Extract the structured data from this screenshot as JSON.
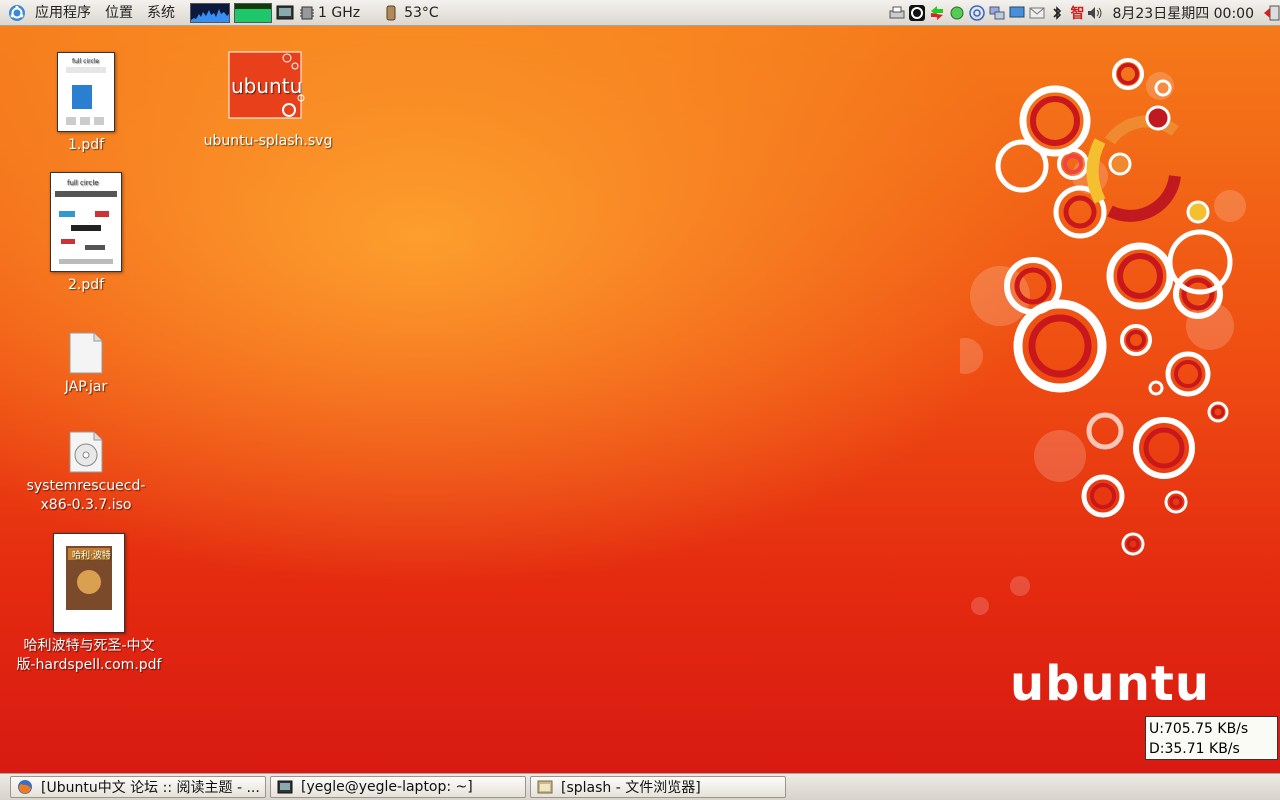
{
  "top_panel": {
    "menus": [
      "应用程序",
      "位置",
      "系统"
    ],
    "cpu_freq": "1 GHz",
    "temperature": "53°C",
    "clock": "8月23日星期四 00:00",
    "tray_icons": [
      "printer-icon",
      "a-icon",
      "network-arrows-icon",
      "green-dot-icon",
      "wifi-icon",
      "network-icon",
      "monitor-icon",
      "mail-icon",
      "bluetooth-icon",
      "ime-icon",
      "volume-icon",
      "logout-icon"
    ],
    "ime_label": "智"
  },
  "desktop": {
    "icons": [
      {
        "name": "1.pdf"
      },
      {
        "name": "ubuntu-splash.svg"
      },
      {
        "name": "2.pdf"
      },
      {
        "name": "JAP.jar"
      },
      {
        "name": "systemrescuecd-x86-0.3.7.iso"
      },
      {
        "name": "哈利波特与死圣-中文版-hardspell.com.pdf"
      }
    ],
    "thumb_text": {
      "full_circle": "full circle",
      "splash": "ubuntu",
      "book": "哈利·波特"
    },
    "wallpaper_logo": "ubuntu",
    "netspeed": {
      "up": "U:705.75 KB/s",
      "down": "D:35.71 KB/s"
    }
  },
  "taskbar": {
    "tasks": [
      {
        "label": "[Ubuntu中文 论坛 :: 阅读主题 - ..."
      },
      {
        "label": "[yegle@yegle-laptop: ~]"
      },
      {
        "label": "[splash - 文件浏览器]"
      }
    ]
  },
  "colors": {
    "accent": "#e42a10",
    "orange": "#f57a1a",
    "panel": "#dcd8d0"
  }
}
